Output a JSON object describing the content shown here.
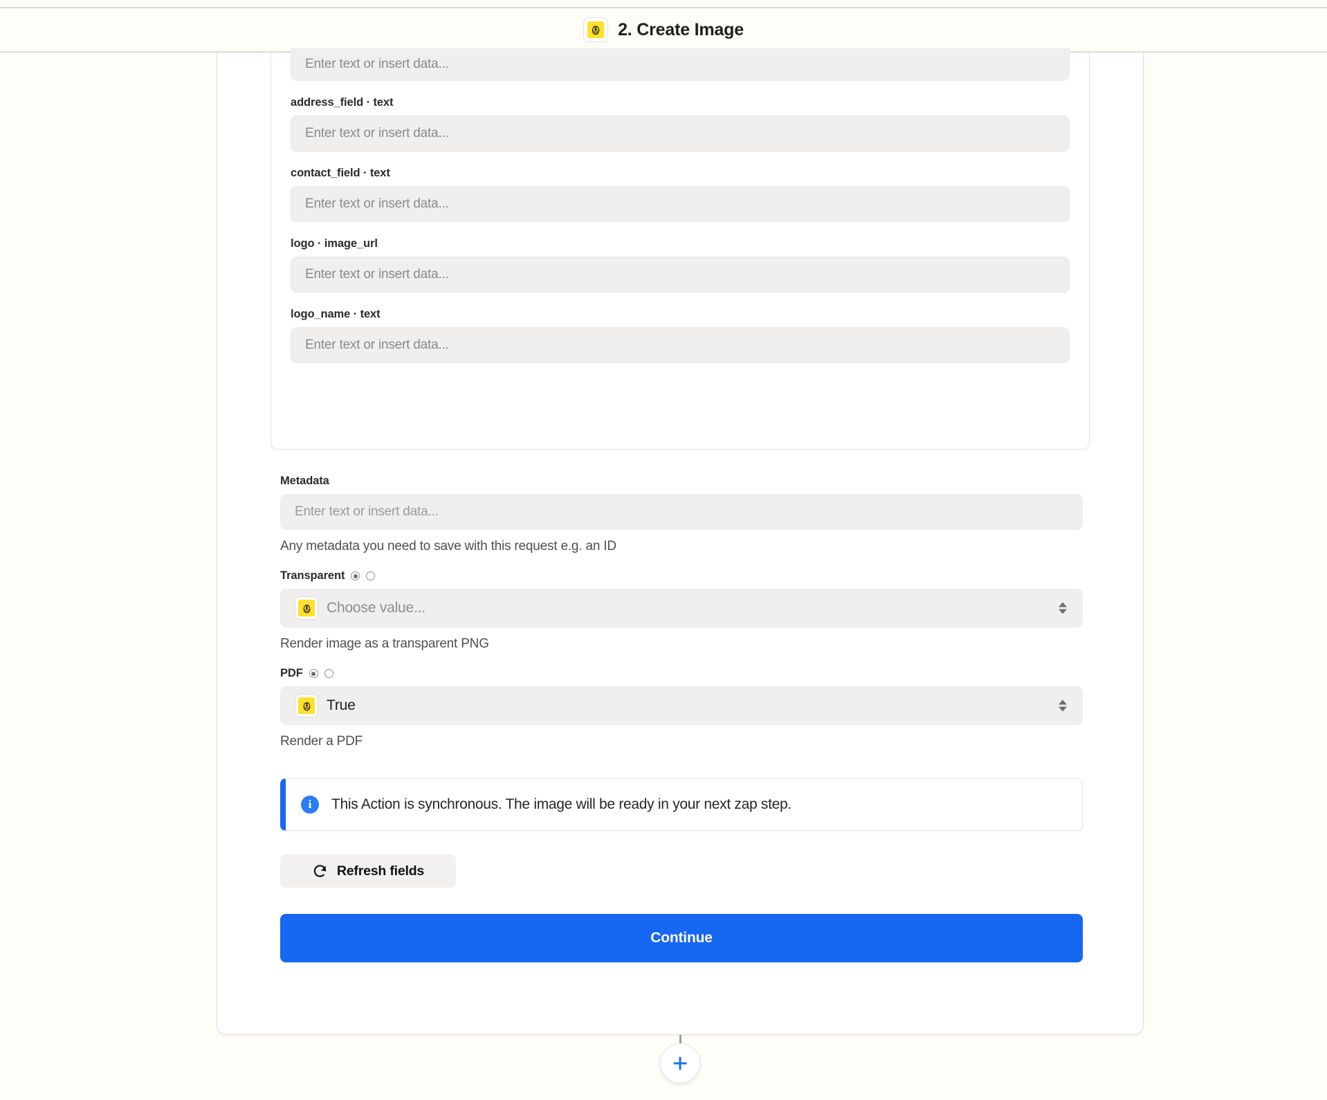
{
  "header": {
    "step_title": "2. Create Image",
    "app_icon": "zapier-app-icon"
  },
  "form": {
    "grouped_fields": [
      {
        "label": "",
        "label_visible": false,
        "placeholder": "Enter text or insert data...",
        "clipped": true
      },
      {
        "label": "address_field · text",
        "placeholder": "Enter text or insert data...",
        "clipped": false
      },
      {
        "label": "contact_field · text",
        "placeholder": "Enter text or insert data...",
        "clipped": false
      },
      {
        "label": "logo · image_url",
        "placeholder": "Enter text or insert data...",
        "clipped": false
      },
      {
        "label": "logo_name · text",
        "placeholder": "Enter text or insert data...",
        "clipped": false
      }
    ],
    "metadata": {
      "label": "Metadata",
      "placeholder": "Enter text or insert data...",
      "help": "Any metadata you need to save with this request e.g. an ID"
    },
    "transparent": {
      "label": "Transparent",
      "value": "Choose value...",
      "has_value": false,
      "help": "Render image as a transparent PNG"
    },
    "pdf": {
      "label": "PDF",
      "value": "True",
      "has_value": true,
      "help": "Render a PDF"
    }
  },
  "banner": {
    "icon": "info-icon",
    "text": "This Action is synchronous. The image will be ready in your next zap step."
  },
  "actions": {
    "refresh_label": "Refresh fields",
    "refresh_icon": "refresh-icon",
    "continue_label": "Continue",
    "add_step_icon": "plus-icon"
  },
  "colors": {
    "accent_blue": "#1667F2",
    "banner_blue": "#1B66F5",
    "brand_yellow": "#FFE02B",
    "page_bg": "#FFFDF7",
    "input_bg": "#F0EFED"
  }
}
